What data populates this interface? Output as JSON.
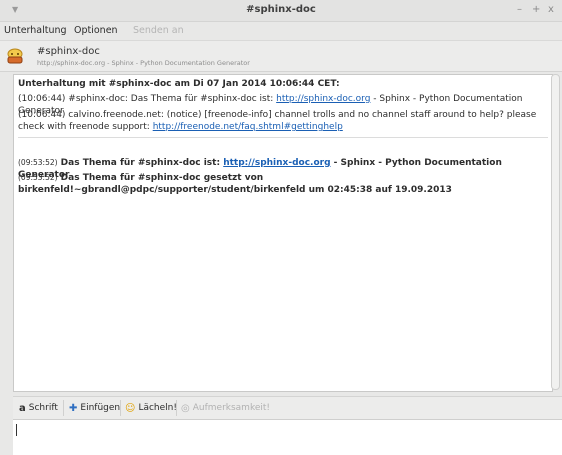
{
  "window": {
    "title": "#sphinx-doc",
    "minimize": "–",
    "maximize": "+",
    "close": "x"
  },
  "menu": {
    "items": [
      "Unterhaltung",
      "Optionen",
      "Senden an"
    ]
  },
  "conversation": {
    "name": "#sphinx-doc",
    "topic": "http://sphinx-doc.org - Sphinx - Python Documentation Generator"
  },
  "log": {
    "header": "Unterhaltung mit #sphinx-doc am Di 07 Jan 2014 10:06:44 CET:",
    "line1_prefix": "(10:06:44) #sphinx-doc: Das Thema für #sphinx-doc ist: ",
    "line1_link": "http://sphinx-doc.org",
    "line1_suffix": " - Sphinx - Python Documentation Generator",
    "line2_prefix": "(10:06:44) calvino.freenode.net: (notice) [freenode-info] channel trolls and no channel staff around to help? please check with freenode support: ",
    "line2_link": "http://freenode.net/faq.shtml#gettinghelp",
    "line3_ts": "(09:53:52)",
    "line3_prefix": " Das Thema für #sphinx-doc ist: ",
    "line3_link": "http://sphinx-doc.org",
    "line3_suffix": " - Sphinx - Python Documentation Generator",
    "line4_ts": "(09:53:52)",
    "line4_text": " Das Thema für #sphinx-doc gesetzt von birkenfeld!~gbrandl@pdpc/supporter/student/birkenfeld um 02:45:38 auf 19.09.2013"
  },
  "toolbar": {
    "font": "Schrift",
    "insert": "Einfügen",
    "smile": "Lächeln!",
    "attention": "Aufmerksamkeit!"
  },
  "icons": {
    "menu": "chevron-down-icon",
    "avatar": "chat-icon",
    "font": "font-icon",
    "insert": "plus-icon",
    "smile": "smiley-icon",
    "attention": "attention-icon"
  }
}
